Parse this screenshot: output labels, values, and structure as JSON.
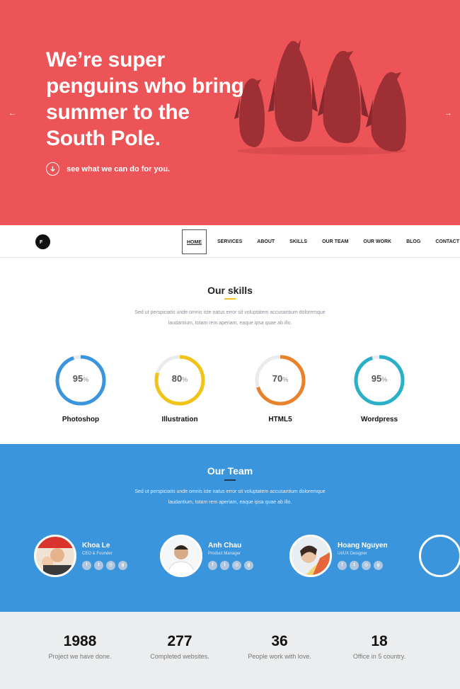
{
  "hero": {
    "lines": [
      "We’re super",
      "penguins who bring",
      "summer to the",
      "South Pole."
    ],
    "cta": "see what we can do for you.",
    "prev_glyph": "←",
    "next_glyph": "→",
    "bg_color": "#ec5457"
  },
  "nav": {
    "logo_text": "F",
    "items": [
      "HOME",
      "SERVICES",
      "ABOUT",
      "SKILLS",
      "OUR TEAM",
      "OUR WORK",
      "BLOG",
      "CONTACT"
    ],
    "active": "HOME"
  },
  "skills": {
    "title": "Our skills",
    "desc_line1": "Sed ut perspiciatis unde omnis iste natus error sit voluptatem accusantium doloremque",
    "desc_line2": "laudantium, totam rem aperiam, eaque ipsa quae ab illo.",
    "items": [
      {
        "name": "Photoshop",
        "value": "95",
        "percent": 95,
        "color": "#3b95dc"
      },
      {
        "name": "Illustration",
        "value": "80",
        "percent": 80,
        "color": "#f2c318"
      },
      {
        "name": "HTML5",
        "value": "70",
        "percent": 70,
        "color": "#e8822b"
      },
      {
        "name": "Wordpress",
        "value": "95",
        "percent": 95,
        "color": "#2ab0c7"
      }
    ],
    "percent_sign": "%"
  },
  "team": {
    "title": "Our Team",
    "desc_line1": "Sed ut perspiciatis unde omnis iste natus error sit voluptatem accusantium doloremque",
    "desc_line2": "laudantium, totam rem aperiam, eaque ipsa quae ab illo.",
    "bg_color": "#3b95dc",
    "members": [
      {
        "name": "Khoa Le",
        "role": "CEO & Founder"
      },
      {
        "name": "Anh Chau",
        "role": "Product Manager"
      },
      {
        "name": "Hoang Nguyen",
        "role": "UI/UX Designer"
      }
    ],
    "social_icons": [
      "facebook-icon",
      "twitter-icon",
      "dribbble-icon",
      "google-plus-icon"
    ],
    "social_glyphs": [
      "f",
      "t",
      "◎",
      "g"
    ]
  },
  "stats": [
    {
      "number": "1988",
      "label": "Project we have done."
    },
    {
      "number": "277",
      "label": "Completed websites."
    },
    {
      "number": "36",
      "label": "People work with love."
    },
    {
      "number": "18",
      "label": "Office in 5 country."
    }
  ]
}
